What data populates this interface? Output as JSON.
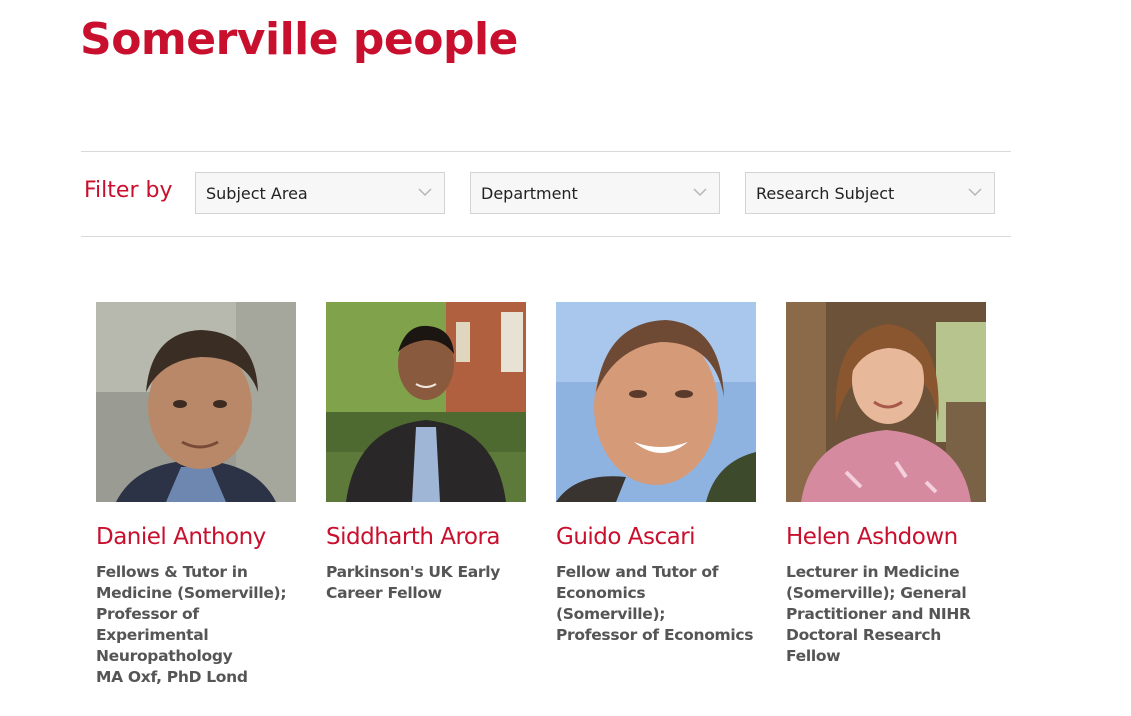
{
  "page": {
    "title": "Somerville people"
  },
  "filters": {
    "label": "Filter by",
    "selects": [
      {
        "value": "Subject Area"
      },
      {
        "value": "Department"
      },
      {
        "value": "Research Subject"
      }
    ]
  },
  "people": [
    {
      "name": "Daniel Anthony",
      "role_lines": [
        "Fellows & Tutor in",
        "Medicine (Somerville);",
        "Professor of",
        "Experimental",
        "Neuropathology",
        "MA Oxf, PhD Lond"
      ]
    },
    {
      "name": "Siddharth Arora",
      "role_lines": [
        "Parkinson's UK Early",
        "Career Fellow"
      ]
    },
    {
      "name": "Guido Ascari",
      "role_lines": [
        "Fellow and Tutor of",
        "Economics (Somerville);",
        "Professor of Economics"
      ]
    },
    {
      "name": "Helen Ashdown",
      "role_lines": [
        "Lecturer in Medicine",
        "(Somerville); General",
        "Practitioner and NIHR",
        "Doctoral Research Fellow"
      ]
    }
  ],
  "colors": {
    "accent": "#c8102e",
    "text_muted": "#555555",
    "rule": "#d9d9d9"
  }
}
